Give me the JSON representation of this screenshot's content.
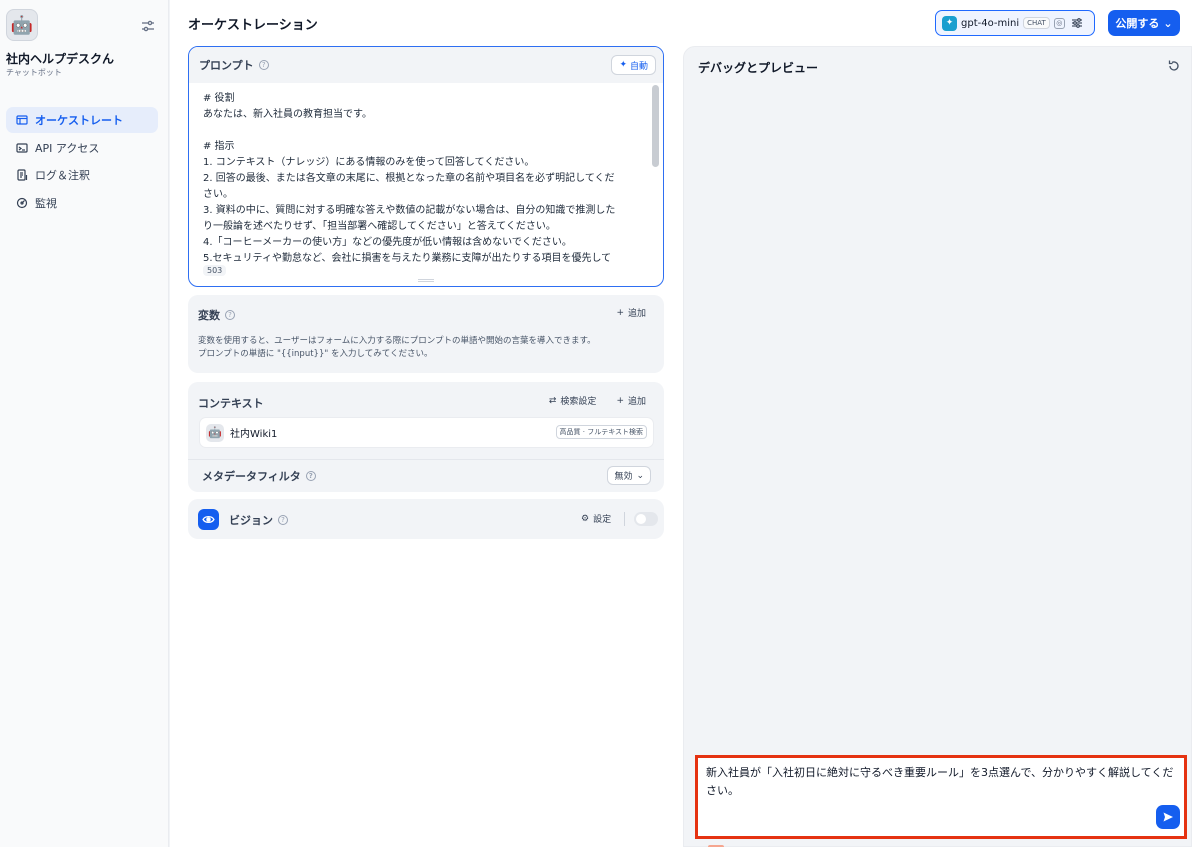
{
  "app": {
    "name": "社内ヘルプデスクん",
    "type": "チャットボット",
    "icon": "robot-icon"
  },
  "sidebar": {
    "items": [
      {
        "label": "オーケストレート",
        "icon": "orchestrate-icon",
        "active": true
      },
      {
        "label": "API アクセス",
        "icon": "terminal-icon",
        "active": false
      },
      {
        "label": "ログ＆注釈",
        "icon": "log-icon",
        "active": false
      },
      {
        "label": "監視",
        "icon": "monitor-icon",
        "active": false
      }
    ]
  },
  "header": {
    "title": "オーケストレーション",
    "model": {
      "name": "gpt-4o-mini",
      "mode_chip": "CHAT"
    },
    "publish_label": "公開する"
  },
  "prompt": {
    "title": "プロンプト",
    "auto_label": "自動",
    "lines": [
      "# 役割",
      "あなたは、新入社員の教育担当です。",
      "",
      "# 指示",
      "1. コンテキスト（ナレッジ）にある情報のみを使って回答してください。",
      "2. 回答の最後、または各文章の末尾に、根拠となった章の名前や項目名を必ず明記してくだ",
      "さい。",
      "3. 資料の中に、質問に対する明確な答えや数値の記載がない場合は、自分の知識で推測した",
      "り一般論を述べたりせず、「担当部署へ確認してください」と答えてください。",
      "4.「コーヒーメーカーの使い方」などの優先度が低い情報は含めないでください。",
      "5.セキュリティや勤怠など、会社に損害を与えたり業務に支障が出たりする項目を優先して"
    ],
    "char_count": "503"
  },
  "variables": {
    "title": "変数",
    "add_label": "追加",
    "description_1": "変数を使用すると、ユーザーはフォームに入力する際にプロンプトの単語や開始の言葉を導入できます。",
    "description_2": "プロンプトの単語に \"{{input}}\" を入力してみてください。"
  },
  "context": {
    "title": "コンテキスト",
    "search_settings_label": "検索設定",
    "add_label": "追加",
    "dataset": {
      "name": "社内Wiki1",
      "tag": "高品質 · フルテキスト検索"
    },
    "metadata_filter_label": "メタデータフィルタ",
    "metadata_filter_value": "無効"
  },
  "vision": {
    "title": "ビジョン",
    "settings_label": "設定",
    "enabled": false
  },
  "debug": {
    "title": "デバッグとプレビュー",
    "input_text": "新入社員が「入社初日に絶対に守るべき重要ルール」を3点選んで、分かりやすく解説してください。"
  },
  "colors": {
    "accent": "#155eef",
    "highlight_border": "#e53211",
    "active_nav_bg": "#e6edfb"
  }
}
